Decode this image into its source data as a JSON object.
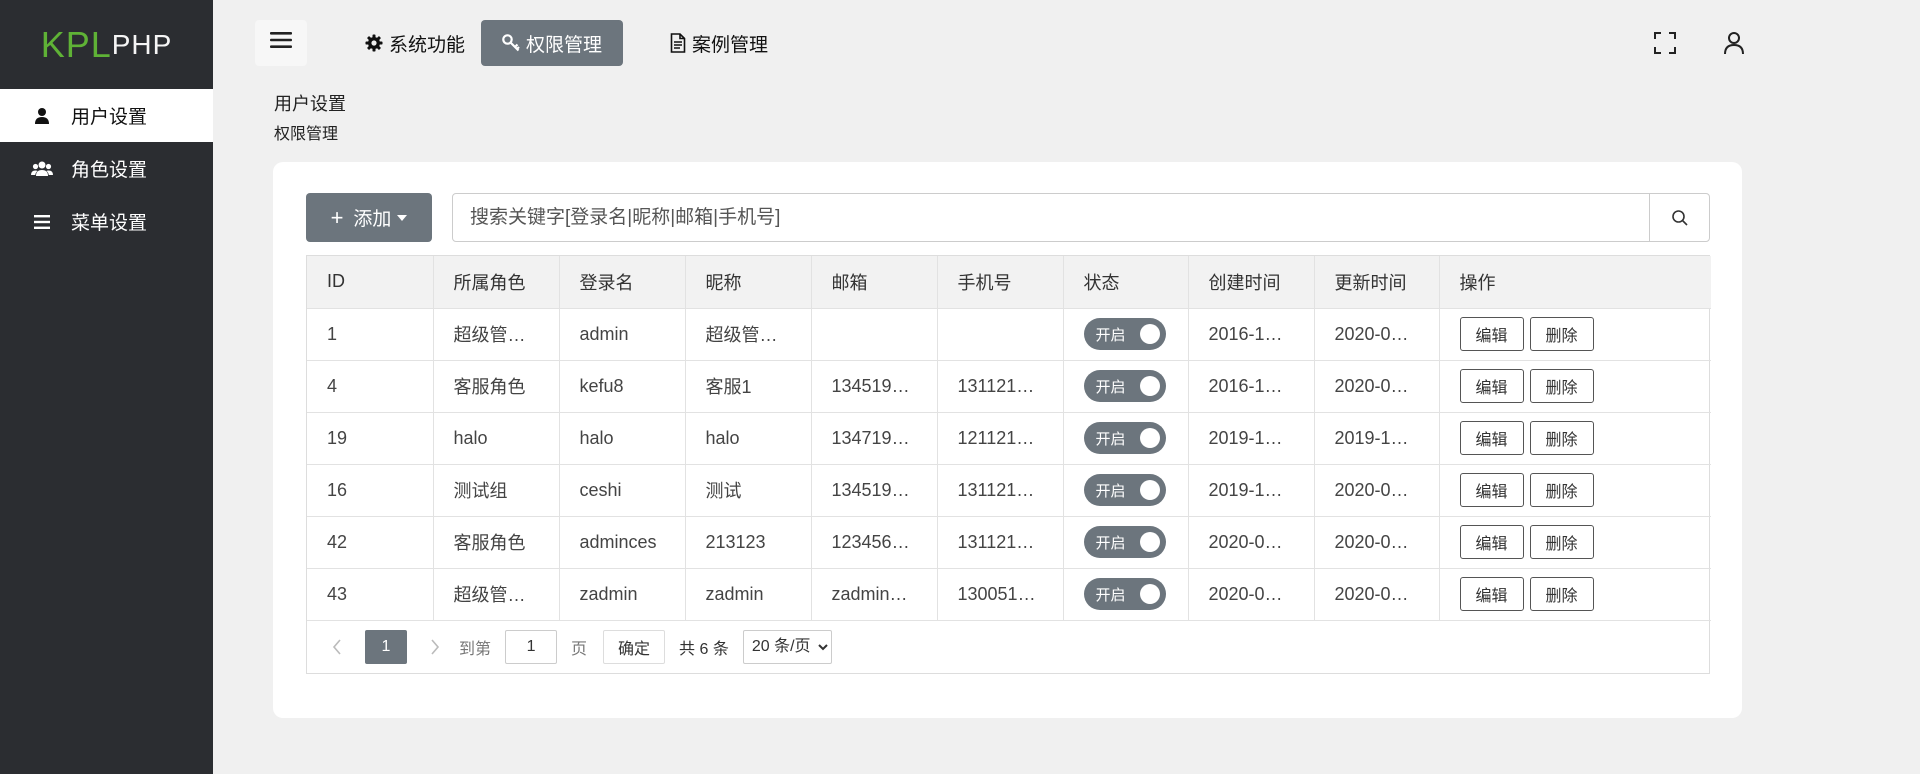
{
  "app": {
    "logo_main": "KPL",
    "logo_sub": "PHP"
  },
  "sidebar": {
    "items": [
      {
        "label": "用户设置",
        "icon": "user-icon",
        "active": true
      },
      {
        "label": "角色设置",
        "icon": "users-icon",
        "active": false
      },
      {
        "label": "菜单设置",
        "icon": "list-icon",
        "active": false
      }
    ]
  },
  "topnav": {
    "menu_icon": "hamburger-icon",
    "items": [
      {
        "label": "系统功能",
        "icon": "gear-icon"
      },
      {
        "label": "权限管理",
        "icon": "key-icon",
        "active": true
      },
      {
        "label": "案例管理",
        "icon": "document-icon"
      }
    ],
    "right_icons": [
      "fullscreen-icon",
      "user-outline-icon"
    ]
  },
  "breadcrumb": {
    "level1": "用户设置",
    "level2": "权限管理"
  },
  "toolbar": {
    "add_label": "添加",
    "search_placeholder": "搜索关键字[登录名|昵称|邮箱|手机号]"
  },
  "table": {
    "headers": [
      "ID",
      "所属角色",
      "登录名",
      "昵称",
      "邮箱",
      "手机号",
      "状态",
      "创建时间",
      "更新时间",
      "操作"
    ],
    "rows": [
      {
        "id": "1",
        "role": "超级管…",
        "login": "admin",
        "nick": "超级管…",
        "email": "",
        "phone": "",
        "status": "开启",
        "created": "2016-1…",
        "updated": "2020-0…"
      },
      {
        "id": "4",
        "role": "客服角色",
        "login": "kefu8",
        "nick": "客服1",
        "email": "134519…",
        "phone": "131121…",
        "status": "开启",
        "created": "2016-1…",
        "updated": "2020-0…"
      },
      {
        "id": "19",
        "role": "halo",
        "login": "halo",
        "nick": "halo",
        "email": "134719…",
        "phone": "121121…",
        "status": "开启",
        "created": "2019-1…",
        "updated": "2019-1…"
      },
      {
        "id": "16",
        "role": "测试组",
        "login": "ceshi",
        "nick": "测试",
        "email": "134519…",
        "phone": "131121…",
        "status": "开启",
        "created": "2019-1…",
        "updated": "2020-0…"
      },
      {
        "id": "42",
        "role": "客服角色",
        "login": "adminces",
        "nick": "213123",
        "email": "123456…",
        "phone": "131121…",
        "status": "开启",
        "created": "2020-0…",
        "updated": "2020-0…"
      },
      {
        "id": "43",
        "role": "超级管…",
        "login": "zadmin",
        "nick": "zadmin",
        "email": "zadmin…",
        "phone": "130051…",
        "status": "开启",
        "created": "2020-0…",
        "updated": "2020-0…"
      }
    ],
    "actions": {
      "edit": "编辑",
      "delete": "删除"
    }
  },
  "pagination": {
    "current_page": "1",
    "goto_label": "到第",
    "goto_value": "1",
    "page_unit": "页",
    "confirm_label": "确定",
    "total_text": "共 6 条",
    "page_size_options": [
      "20 条/页"
    ],
    "page_size_selected": "20 条/页"
  },
  "colors": {
    "sidebar_bg": "#2b2d31",
    "logo_green": "#5fb236",
    "accent_gray": "#6c757d",
    "page_bg": "#f0f0f0"
  }
}
